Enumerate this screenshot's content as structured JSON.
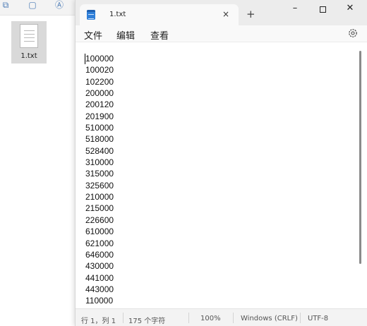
{
  "explorer": {
    "file_name": "1.txt"
  },
  "tab": {
    "title": "1.txt",
    "close_glyph": "×",
    "new_tab_glyph": "+"
  },
  "window_controls": {
    "minimize_glyph": "–",
    "close_glyph": "✕"
  },
  "menu": {
    "file": "文件",
    "edit": "编辑",
    "view": "查看"
  },
  "content": {
    "lines": [
      "100000",
      "100020",
      "102200",
      "200000",
      "200120",
      "201900",
      "510000",
      "518000",
      "528400",
      "310000",
      "315000",
      "325600",
      "210000",
      "215000",
      "226600",
      "610000",
      "621000",
      "646000",
      "430000",
      "441000",
      "443000",
      "110000"
    ]
  },
  "status": {
    "position": "行 1，列 1",
    "chars": "175 个字符",
    "zoom": "100%",
    "line_ending": "Windows (CRLF)",
    "encoding": "UTF-8"
  },
  "colors": {
    "accent": "#2f7fd8",
    "titlebar": "#ececec",
    "statusbar": "#f3f3f3"
  }
}
